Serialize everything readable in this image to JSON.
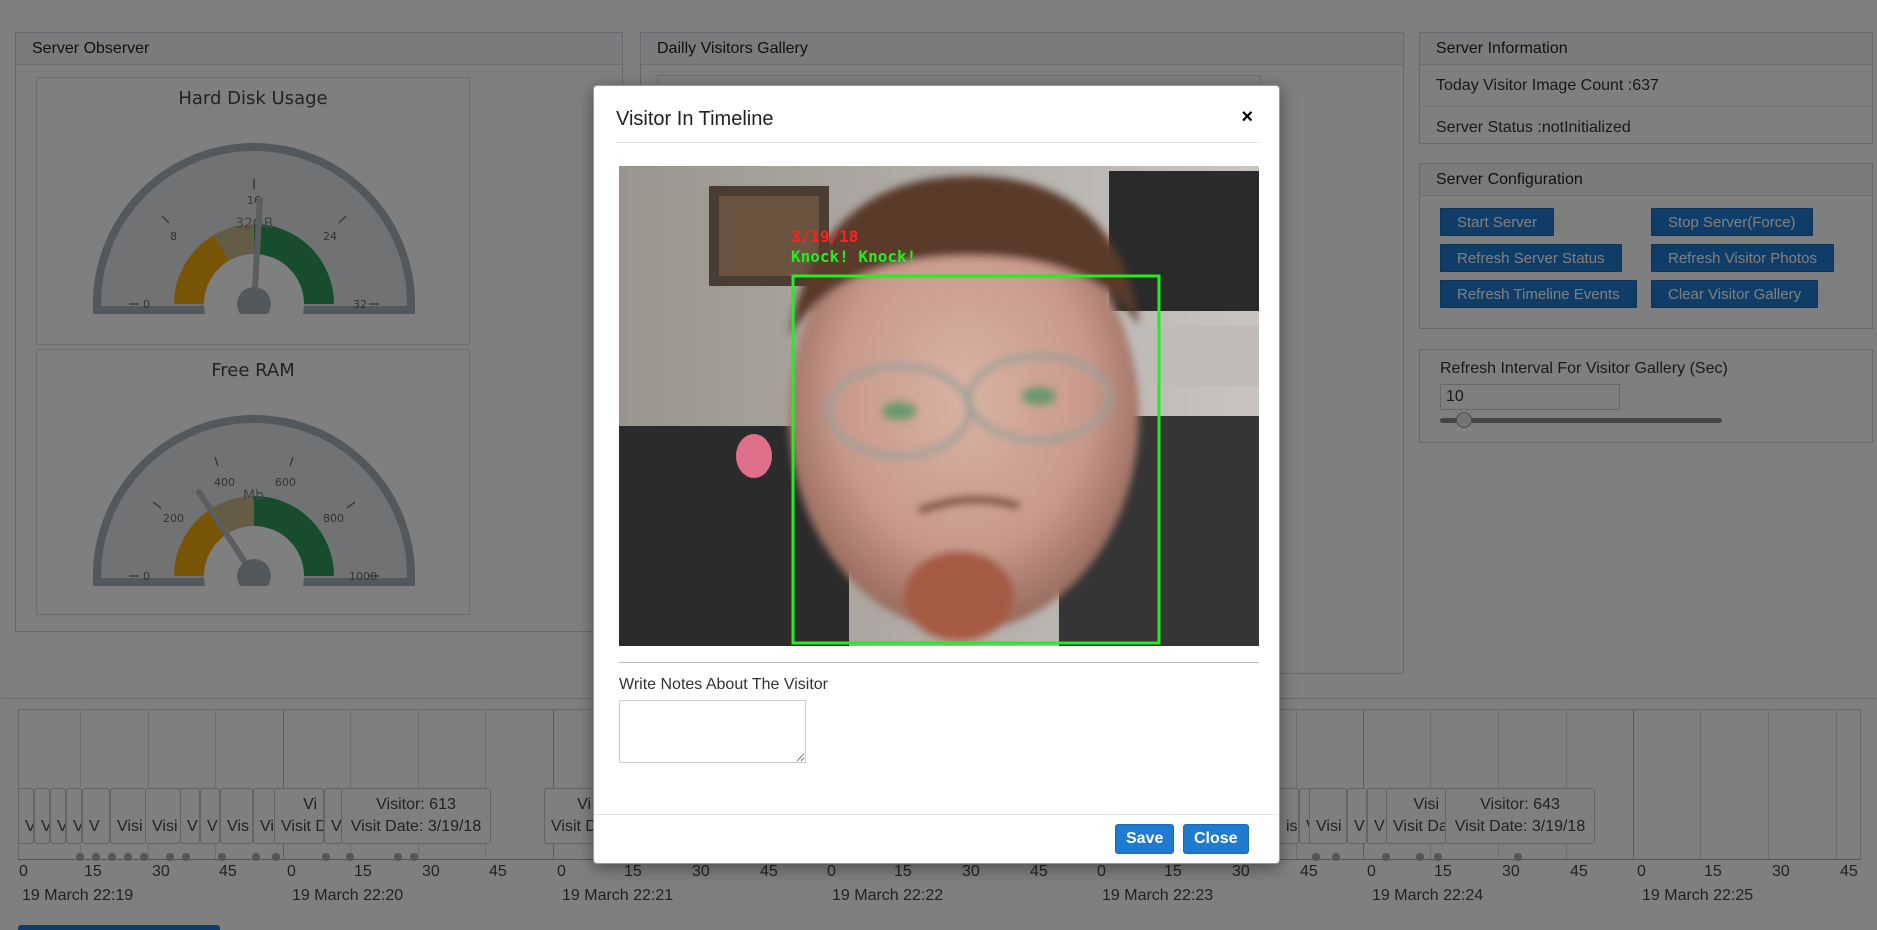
{
  "observer": {
    "title": "Server Observer",
    "disk": {
      "title": "Hard Disk Usage",
      "unit": "32GB",
      "ticks": [
        "0",
        "8",
        "16",
        "24",
        "32"
      ],
      "value_fraction": 0.52
    },
    "ram": {
      "title": "Free RAM",
      "unit": "Mb",
      "ticks": [
        "0",
        "200",
        "400",
        "600",
        "800",
        "1000"
      ],
      "value_fraction": 0.3
    }
  },
  "gallery": {
    "title": "Dailly Visitors Gallery"
  },
  "info": {
    "title": "Server Information",
    "image_count": "Today Visitor Image Count :637",
    "status": "Server Status :notInitialized"
  },
  "config": {
    "title": "Server Configuration",
    "buttons": {
      "start": "Start Server",
      "stop": "Stop Server(Force)",
      "refresh_status": "Refresh Server Status",
      "refresh_photos": "Refresh Visitor Photos",
      "refresh_timeline": "Refresh Timeline Events",
      "clear_gallery": "Clear Visitor Gallery"
    }
  },
  "interval": {
    "label": "Refresh Interval For Visitor Gallery (Sec)",
    "value": "10"
  },
  "timeline": {
    "tick_labels": [
      "0",
      "15",
      "30",
      "45",
      "0",
      "15",
      "30",
      "45",
      "0",
      "15",
      "30",
      "45",
      "0",
      "15",
      "30",
      "45",
      "0",
      "15",
      "30",
      "45",
      "0",
      "15",
      "30",
      "45",
      "0",
      "15",
      "30",
      "45"
    ],
    "dates": [
      "19 March 22:19",
      "19 March 22:20",
      "19 March 22:21",
      "19 March 22:22",
      "19 March 22:23",
      "19 March 22:24",
      "19 March 22:25"
    ],
    "items": {
      "a1": "V",
      "a2": "V",
      "a3": "V",
      "a4": "V",
      "a5": "V",
      "b1": "Visi",
      "b2": "Visi",
      "b3": "V",
      "b4": "V",
      "b5": "Vis",
      "b6": "Vi",
      "c1_line1": "Vi",
      "c1_line2": "Visit D",
      "c2": "V",
      "d1_line1": "Visitor: 613",
      "d1_line2": "Visit Date: 3/19/18",
      "e1_line1": "Vi",
      "e1_line2": "Visit D",
      "f1": "is",
      "f2": "V",
      "f3": "Visi",
      "f4": "V",
      "f5": "V",
      "g1_line1": "Visi",
      "g1_line2": "Visit Da",
      "h1_line1": "Visitor: 643",
      "h1_line2": "Visit Date: 3/19/18"
    }
  },
  "modal": {
    "title": "Visitor In Timeline",
    "close_symbol": "×",
    "photo_date": "3/19/18",
    "photo_caption": "Knock! Knock!",
    "notes_label": "Write Notes About The Visitor",
    "notes_value": "",
    "save": "Save",
    "close": "Close"
  },
  "colors": {
    "accent": "#1f7bd0",
    "gauge_green": "#2e9b58",
    "gauge_orange": "#f0a90c",
    "overlay_text_red": "#ff2020",
    "overlay_box_green": "#22ee22"
  }
}
